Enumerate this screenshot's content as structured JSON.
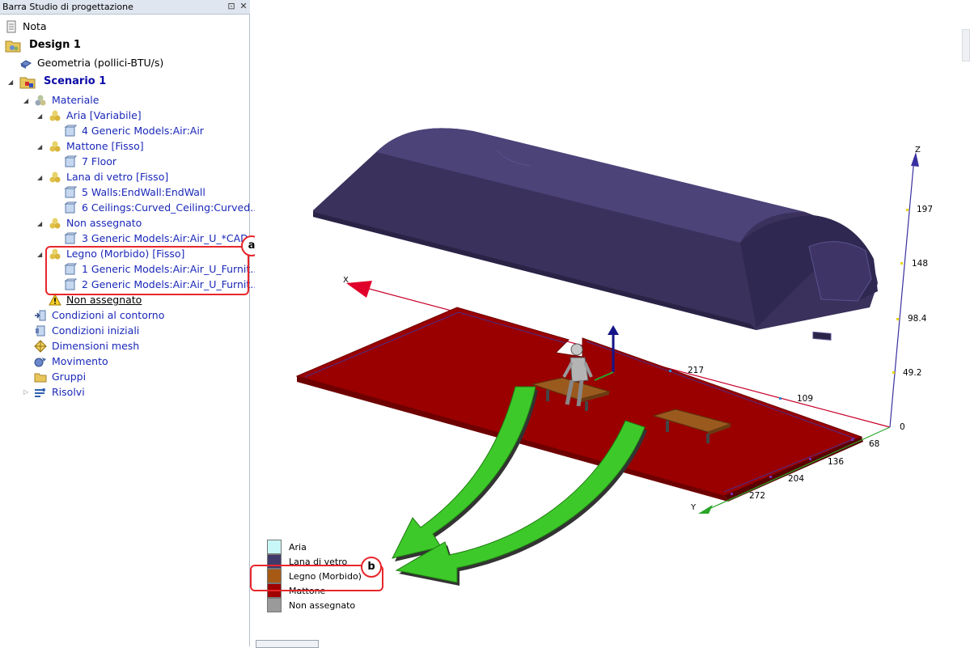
{
  "panel": {
    "title": "Barra Studio di progettazione",
    "pin_icon": "pin-icon",
    "close_icon": "close-icon"
  },
  "tree": {
    "nota": "Nota",
    "design": "Design 1",
    "geometria": "Geometria (pollici-BTU/s)",
    "scenario": "Scenario 1",
    "materiale": "Materiale",
    "aria": "Aria [Variabile]",
    "aria_child": "4 Generic Models:Air:Air",
    "mattone": "Mattone [Fisso]",
    "mattone_child": "7 Floor",
    "lana": "Lana di vetro [Fisso]",
    "lana_child1": "5 Walls:EndWall:EndWall",
    "lana_child2": "6 Ceilings:Curved_Ceiling:Curved...",
    "non_assegnato_group": "Non assegnato",
    "non_assegnato_child": "3 Generic Models:Air:Air_U_*CAD...",
    "legno": "Legno (Morbido) [Fisso]",
    "legno_child1": "1 Generic Models:Air:Air_U_Furnit...",
    "legno_child2": "2 Generic Models:Air:Air_U_Furnit...",
    "non_assegnato_warning": "Non assegnato",
    "condizioni_contorno": "Condizioni al contorno",
    "condizioni_iniziali": "Condizioni iniziali",
    "dimensioni_mesh": "Dimensioni mesh",
    "movimento": "Movimento",
    "gruppi": "Gruppi",
    "risolvi": "Risolvi"
  },
  "callouts": {
    "a": "a",
    "b": "b"
  },
  "axes": {
    "z_label": "Z",
    "x_label": "X",
    "y_label": "Y",
    "z_ticks": [
      "197",
      "148",
      "98.4",
      "49.2",
      "0"
    ],
    "x_ticks": [
      "217",
      "109"
    ],
    "y_ticks": [
      "68",
      "136",
      "204",
      "272"
    ]
  },
  "legend": [
    {
      "label": "Aria",
      "color": "#c8f7f7"
    },
    {
      "label": "Lana di vetro",
      "color": "#403a6a"
    },
    {
      "label": "Legno (Morbido)",
      "color": "#a65a14"
    },
    {
      "label": "Mattone",
      "color": "#a00000"
    },
    {
      "label": "Non assegnato",
      "color": "#9a9a9a"
    }
  ],
  "colors": {
    "accent_red": "#e8262b",
    "floor": "#9c0000",
    "ceiling": "#3d3462",
    "arrow_green": "#3ec92a"
  }
}
